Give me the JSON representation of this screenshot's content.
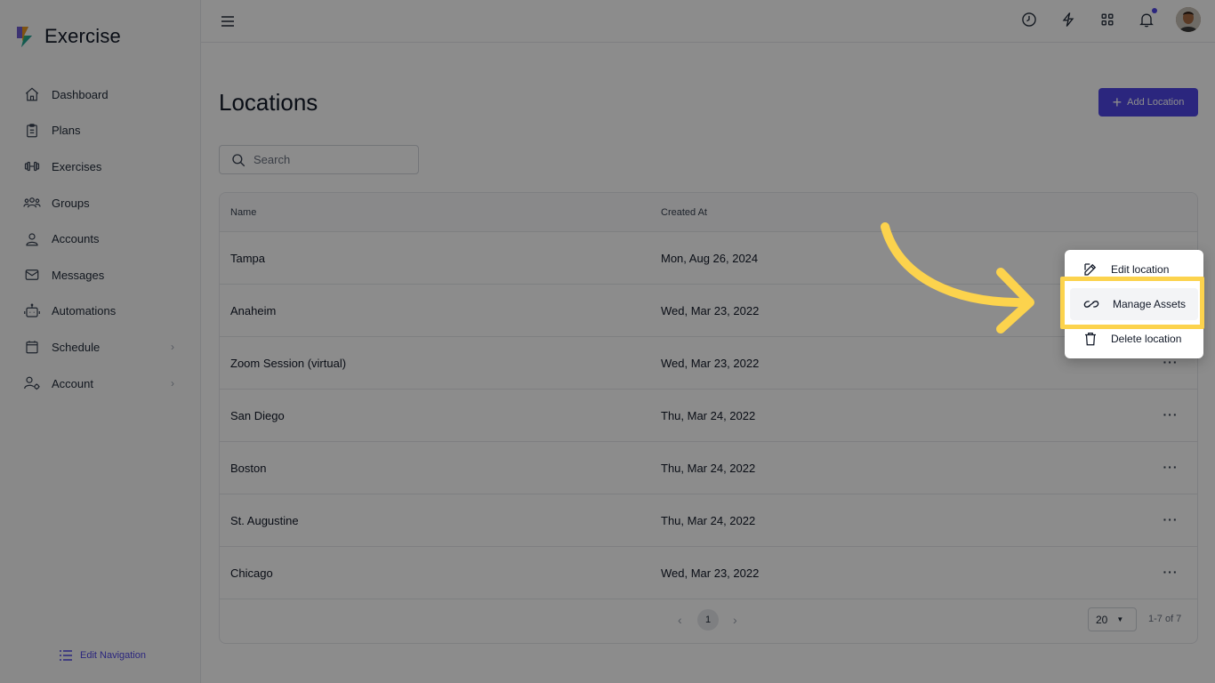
{
  "app": {
    "name": "Exercise"
  },
  "sidebar": {
    "items": [
      {
        "label": "Dashboard",
        "icon": "home-icon"
      },
      {
        "label": "Plans",
        "icon": "clipboard-icon"
      },
      {
        "label": "Exercises",
        "icon": "dumbbell-icon"
      },
      {
        "label": "Groups",
        "icon": "group-icon"
      },
      {
        "label": "Accounts",
        "icon": "user-icon"
      },
      {
        "label": "Messages",
        "icon": "mail-icon"
      },
      {
        "label": "Automations",
        "icon": "robot-icon"
      },
      {
        "label": "Schedule",
        "icon": "calendar-icon",
        "has_submenu": true
      },
      {
        "label": "Account",
        "icon": "user-gear-icon",
        "has_submenu": true
      }
    ],
    "edit_navigation": "Edit Navigation"
  },
  "topbar": {
    "icons": [
      "clock-icon",
      "bolt-icon",
      "grid-icon",
      "bell-icon",
      "avatar"
    ]
  },
  "main": {
    "title": "Locations",
    "add_button": "Add Location",
    "search_placeholder": "Search",
    "table": {
      "columns": [
        "Name",
        "Created At"
      ],
      "rows": [
        {
          "name": "Tampa",
          "created": "Mon, Aug 26, 2024"
        },
        {
          "name": "Anaheim",
          "created": "Wed, Mar 23, 2022"
        },
        {
          "name": "Zoom Session (virtual)",
          "created": "Wed, Mar 23, 2022"
        },
        {
          "name": "San Diego",
          "created": "Thu, Mar 24, 2022"
        },
        {
          "name": "Boston",
          "created": "Thu, Mar 24, 2022"
        },
        {
          "name": "St. Augustine",
          "created": "Thu, Mar 24, 2022"
        },
        {
          "name": "Chicago",
          "created": "Wed, Mar 23, 2022"
        }
      ]
    },
    "pagination": {
      "current_page": "1",
      "per_page": "20",
      "range": "1-7 of 7"
    }
  },
  "context_menu": {
    "items": [
      {
        "label": "Edit location",
        "icon": "edit-icon"
      },
      {
        "label": "Manage Assets",
        "icon": "link-icon"
      },
      {
        "label": "Delete location",
        "icon": "trash-icon"
      }
    ]
  },
  "colors": {
    "accent": "#4f46e5",
    "highlight": "#fcd34d"
  }
}
